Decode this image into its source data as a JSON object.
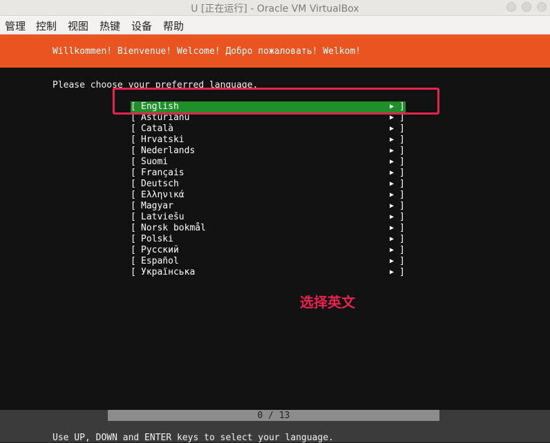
{
  "window": {
    "title": "U [正在运行] - Oracle VM VirtualBox"
  },
  "menu": {
    "items": [
      "管理",
      "控制",
      "视图",
      "热键",
      "设备",
      "帮助"
    ]
  },
  "banner": {
    "text": "Willkommen! Bienvenue! Welcome! Добро пожаловать! Welkom!",
    "color": "#e95420"
  },
  "prompt": "Please choose your preferred language.",
  "languages": [
    {
      "label": "English",
      "selected": true
    },
    {
      "label": "Asturianu"
    },
    {
      "label": "Català"
    },
    {
      "label": "Hrvatski"
    },
    {
      "label": "Nederlands"
    },
    {
      "label": "Suomi"
    },
    {
      "label": "Français"
    },
    {
      "label": "Deutsch"
    },
    {
      "label": "Ελληνικά"
    },
    {
      "label": "Magyar"
    },
    {
      "label": "Latviešu"
    },
    {
      "label": "Norsk bokmål"
    },
    {
      "label": "Polski"
    },
    {
      "label": "Русский"
    },
    {
      "label": "Español"
    },
    {
      "label": "Українська"
    }
  ],
  "list_glyphs": {
    "open": "[",
    "close": "]",
    "arrow": "▶"
  },
  "annotation": {
    "text": "选择英文",
    "color": "#e8234f"
  },
  "progress": {
    "text": "0 / 13"
  },
  "hint": "Use UP, DOWN and ENTER keys to select your language.",
  "colors": {
    "selection": "#1f8f2a",
    "screen_bg": "#121212"
  }
}
